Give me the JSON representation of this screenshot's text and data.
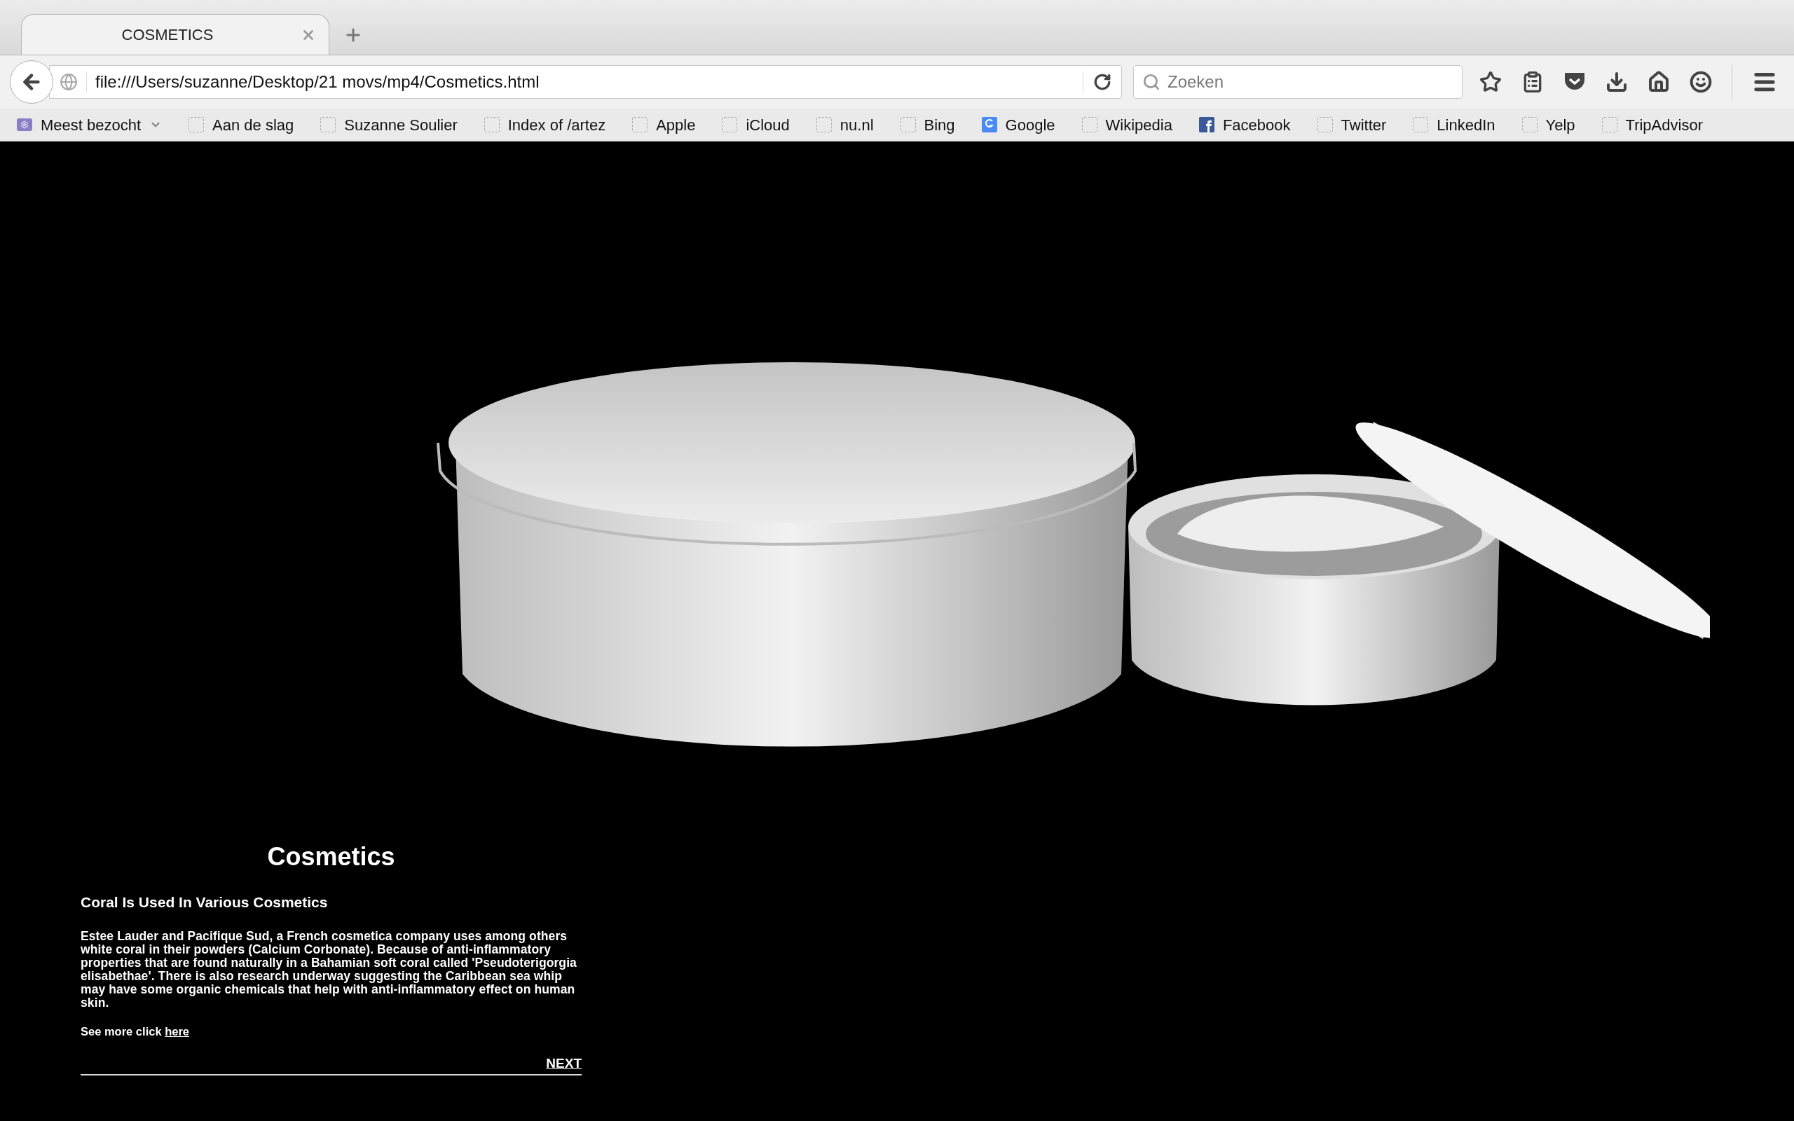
{
  "tabs": [
    {
      "title": "COSMETICS",
      "selected": true
    }
  ],
  "address_bar": {
    "url": "file:///Users/suzanne/Desktop/21 movs/mp4/Cosmetics.html"
  },
  "search": {
    "placeholder": "Zoeken"
  },
  "bookmarks": [
    {
      "label": "Meest bezocht",
      "kind": "folder"
    },
    {
      "label": "Aan de slag",
      "kind": "blank"
    },
    {
      "label": "Suzanne Soulier",
      "kind": "blank"
    },
    {
      "label": "Index of /artez",
      "kind": "blank"
    },
    {
      "label": "Apple",
      "kind": "blank"
    },
    {
      "label": "iCloud",
      "kind": "blank"
    },
    {
      "label": "nu.nl",
      "kind": "blank"
    },
    {
      "label": "Bing",
      "kind": "blank"
    },
    {
      "label": "Google",
      "kind": "google"
    },
    {
      "label": "Wikipedia",
      "kind": "blank"
    },
    {
      "label": "Facebook",
      "kind": "facebook"
    },
    {
      "label": "Twitter",
      "kind": "blank"
    },
    {
      "label": "LinkedIn",
      "kind": "blank"
    },
    {
      "label": "Yelp",
      "kind": "blank"
    },
    {
      "label": "TripAdvisor",
      "kind": "blank"
    }
  ],
  "page": {
    "title": "Cosmetics",
    "subtitle": "Coral Is Used In Various Cosmetics",
    "body": "Estee Lauder and Pacifique Sud, a French cosmetica company uses among others white coral in their powders (Calcium Corbonate). Because of anti-inflammatory properties that are found naturally in a Bahamian soft coral called 'Pseudoterigorgia elisabethae'. There is also research underway suggesting the Caribbean sea whip may have some organic chemicals that help with anti-inflammatory effect on human skin.",
    "see_more": {
      "text": "See more click",
      "link": "here"
    },
    "next": "NEXT"
  }
}
